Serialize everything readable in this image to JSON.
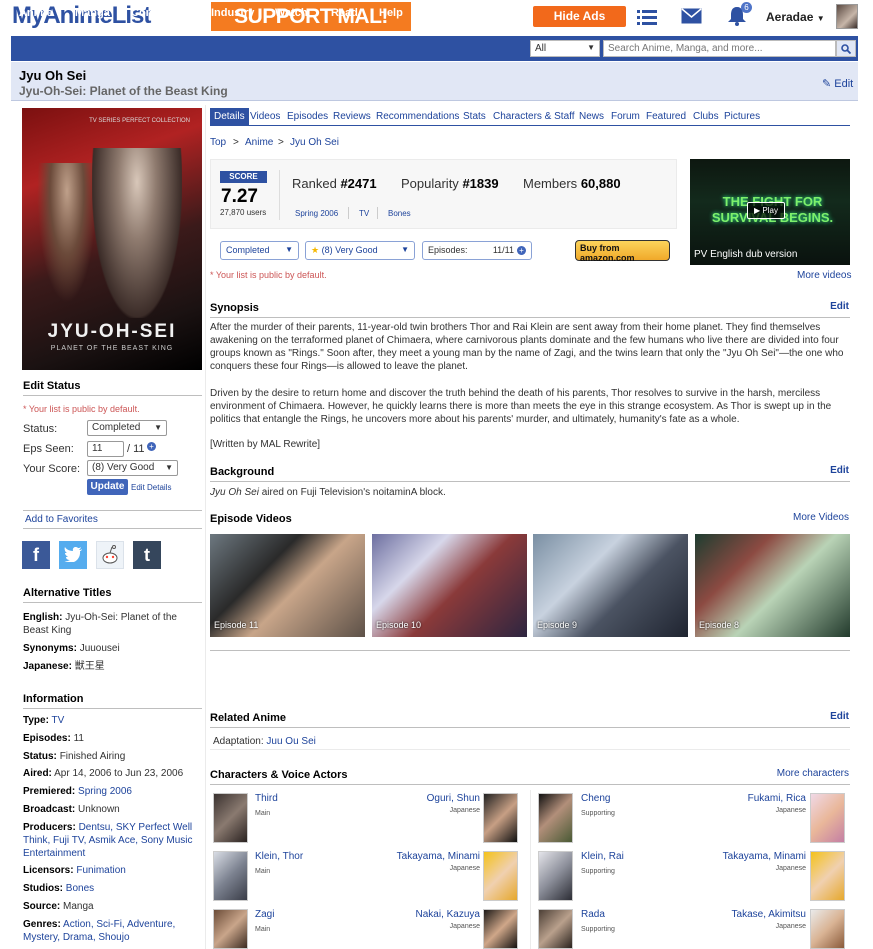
{
  "header": {
    "logo": "MyAnimeList",
    "support": "SUPPORT MAL!",
    "hide_ads": "Hide Ads",
    "notification_count": "6",
    "username": "Aeradae"
  },
  "nav": {
    "items": [
      "Anime",
      "Manga",
      "Community",
      "Industry",
      "Watch",
      "Read",
      "Help"
    ],
    "search_category": "All",
    "search_placeholder": "Search Anime, Manga, and more..."
  },
  "title": {
    "main": "Jyu Oh Sei",
    "english": "Jyu-Oh-Sei: Planet of the Beast King",
    "edit": "Edit"
  },
  "poster": {
    "top_text": "TV SERIES PERFECT COLLECTION",
    "logo": "JYU-OH-SEI",
    "subtitle": "PLANET OF THE BEAST KING"
  },
  "sidebar": {
    "edit_status_title": "Edit Status",
    "public_note": "* Your list is public by default.",
    "status_label": "Status:",
    "status_value": "Completed",
    "eps_label": "Eps Seen:",
    "eps_value": "11",
    "eps_total": "/ 11",
    "score_label": "Your Score:",
    "score_value": "(8) Very Good",
    "update_btn": "Update",
    "edit_details": "Edit Details",
    "add_favorites": "Add to Favorites",
    "alt_titles_title": "Alternative Titles",
    "alt": [
      {
        "k": "English:",
        "v": "Jyu-Oh-Sei: Planet of the Beast King"
      },
      {
        "k": "Synonyms:",
        "v": "Juuousei"
      },
      {
        "k": "Japanese:",
        "v": "獣王星"
      }
    ],
    "info_title": "Information",
    "info": [
      {
        "k": "Type:",
        "v": "TV"
      },
      {
        "k": "Episodes:",
        "v": "11"
      },
      {
        "k": "Status:",
        "v": "Finished Airing"
      },
      {
        "k": "Aired:",
        "v": "Apr 14, 2006 to Jun 23, 2006"
      },
      {
        "k": "Premiered:",
        "v": "Spring 2006"
      },
      {
        "k": "Broadcast:",
        "v": "Unknown"
      },
      {
        "k": "Producers:",
        "v": "Dentsu, SKY Perfect Well Think, Fuji TV, Asmik Ace, Sony Music Entertainment"
      },
      {
        "k": "Licensors:",
        "v": "Funimation"
      },
      {
        "k": "Studios:",
        "v": "Bones"
      },
      {
        "k": "Source:",
        "v": "Manga"
      },
      {
        "k": "Genres:",
        "v": "Action, Sci-Fi, Adventure, Mystery, Drama, Shoujo"
      }
    ]
  },
  "tabs": [
    "Details",
    "Videos",
    "Episodes",
    "Reviews",
    "Recommendations",
    "Stats",
    "Characters & Staff",
    "News",
    "Forum",
    "Featured",
    "Clubs",
    "Pictures"
  ],
  "breadcrumb": [
    "Top",
    "Anime",
    "Jyu Oh Sei"
  ],
  "breadcrumb_sep": ">",
  "score": {
    "badge": "SCORE",
    "value": "7.27",
    "users": "27,870 users",
    "ranked_label": "Ranked",
    "ranked": "#2471",
    "popularity_label": "Popularity",
    "popularity": "#1839",
    "members_label": "Members",
    "members": "60,880",
    "season": "Spring 2006",
    "type": "TV",
    "studio": "Bones"
  },
  "controls": {
    "status": "Completed",
    "score": "(8) Very Good",
    "episodes_label": "Episodes:",
    "episodes": "11/11",
    "public_note": "* Your list is public by default.",
    "amazon": "Buy from amazon.com"
  },
  "pv": {
    "glow": "THE FIGHT FOR SURVIVAL BEGINS.",
    "play": "Play",
    "caption": "PV English dub version",
    "more": "More videos"
  },
  "synopsis": {
    "title": "Synopsis",
    "edit": "Edit",
    "p1": "After the murder of their parents, 11-year-old twin brothers Thor and Rai Klein are sent away from their home planet. They find themselves awakening on the terraformed planet of Chimaera, where carnivorous plants dominate and the few humans who live there are divided into four groups known as \"Rings.\" Soon after, they meet a young man by the name of Zagi, and the twins learn that only the \"Jyu Oh Sei\"—the one who conquers these four Rings—is allowed to leave the planet.",
    "p2": "Driven by the desire to return home and discover the truth behind the death of his parents, Thor resolves to survive in the harsh, merciless environment of Chimaera. However, he quickly learns there is more than meets the eye in this strange ecosystem. As Thor is swept up in the politics that entangle the Rings, he uncovers more about his parents' murder, and ultimately, humanity's fate as a whole.",
    "p3": "[Written by MAL Rewrite]"
  },
  "background": {
    "title": "Background",
    "edit": "Edit",
    "italic": "Jyu Oh Sei",
    "text": " aired on Fuji Television's noitaminA block."
  },
  "episode_videos": {
    "title": "Episode Videos",
    "more": "More Videos",
    "items": [
      "Episode 11",
      "Episode 10",
      "Episode 9",
      "Episode 8"
    ]
  },
  "related": {
    "title": "Related Anime",
    "edit": "Edit",
    "label": "Adaptation:",
    "value": "Juu Ou Sei"
  },
  "characters": {
    "title": "Characters & Voice Actors",
    "more": "More characters",
    "rows": [
      [
        {
          "name": "Third",
          "role": "Main",
          "va": "Oguri, Shun",
          "lang": "Japanese"
        },
        {
          "name": "Cheng",
          "role": "Supporting",
          "va": "Fukami, Rica",
          "lang": "Japanese"
        }
      ],
      [
        {
          "name": "Klein, Thor",
          "role": "Main",
          "va": "Takayama, Minami",
          "lang": "Japanese"
        },
        {
          "name": "Klein, Rai",
          "role": "Supporting",
          "va": "Takayama, Minami",
          "lang": "Japanese"
        }
      ],
      [
        {
          "name": "Zagi",
          "role": "Main",
          "va": "Nakai, Kazuya",
          "lang": "Japanese"
        },
        {
          "name": "Rada",
          "role": "Supporting",
          "va": "Takase, Akimitsu",
          "lang": "Japanese"
        }
      ]
    ]
  },
  "colors": {
    "brand": "#2e51a2",
    "support": "#f47b20",
    "hide_ads": "#f2691b"
  }
}
